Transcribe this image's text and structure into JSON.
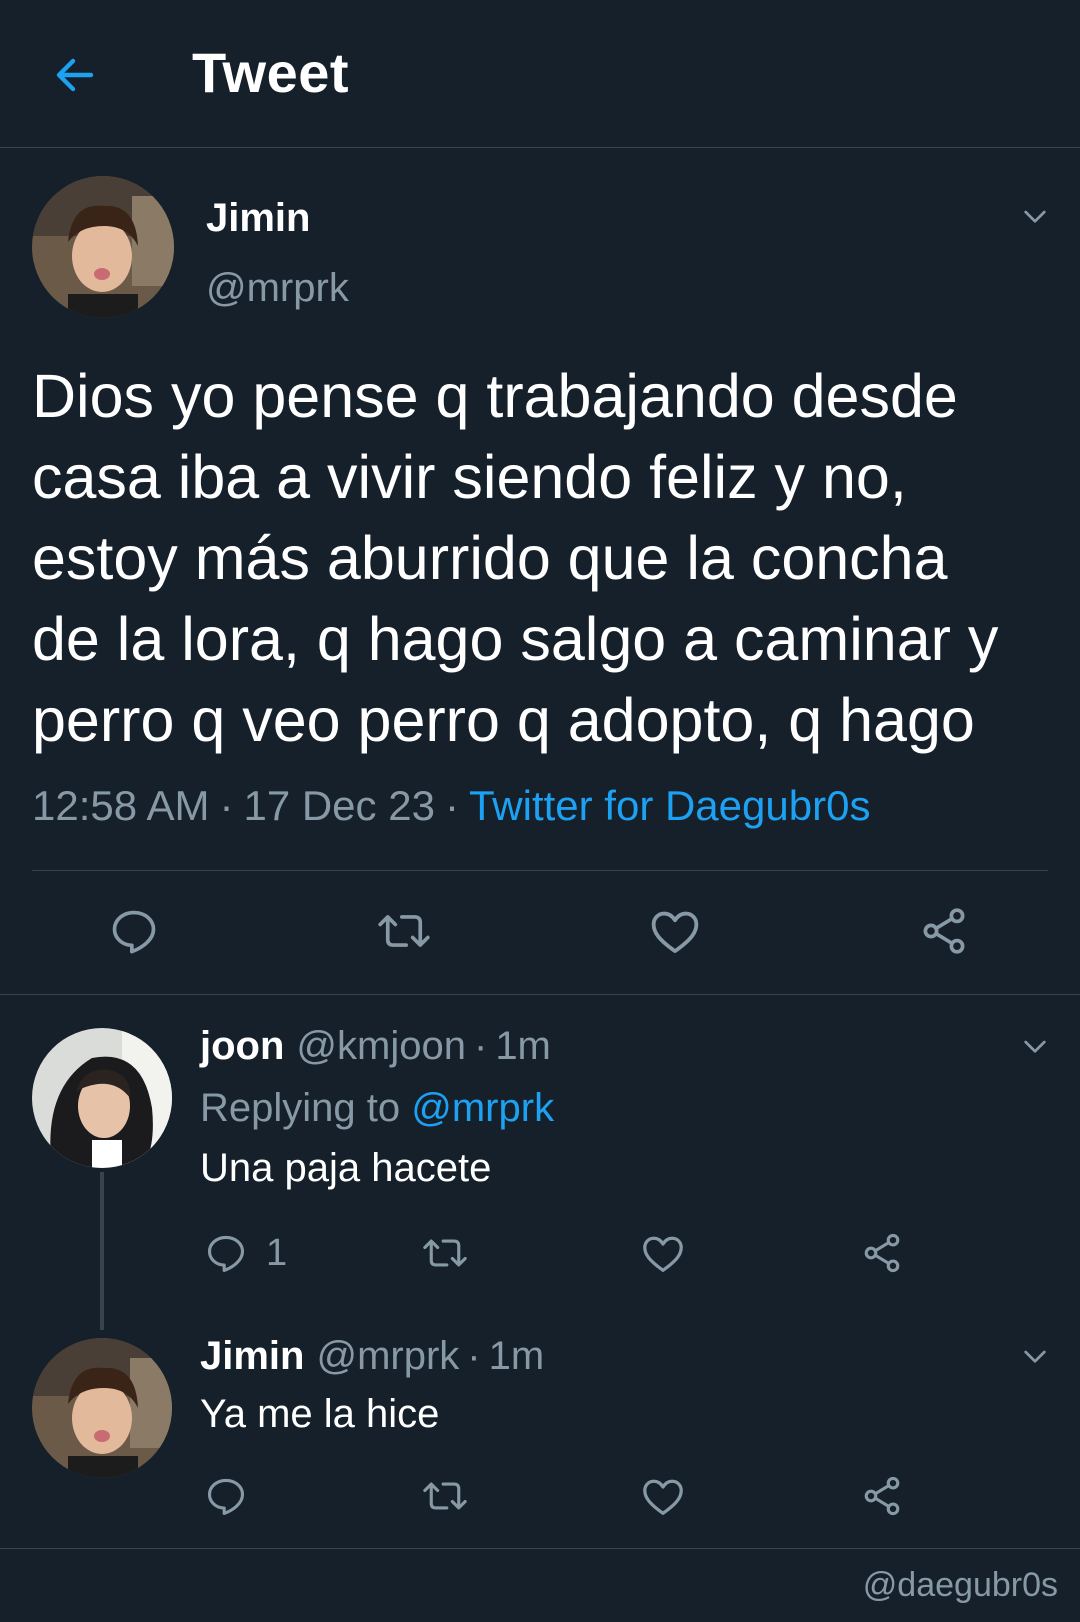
{
  "header": {
    "title": "Tweet",
    "back_icon": "arrow-left-icon",
    "accent_color": "#1da1f2"
  },
  "main_tweet": {
    "name": "Jimin",
    "handle": "@mrprk",
    "text": "Dios yo pense q trabajando desde\ncasa iba a vivir siendo feliz y no,\nestoy más aburrido que la concha\nde la lora, q hago salgo a caminar y\nperro q veo perro q adopto, q hago",
    "time": "12:58 AM",
    "separator": "·",
    "date": "17 Dec 23",
    "source": "Twitter for Daegubr0s",
    "actions": [
      "reply-icon",
      "retweet-icon",
      "like-icon",
      "share-icon"
    ]
  },
  "replies": [
    {
      "name": "joon",
      "handle": "@kmjoon",
      "separator": "·",
      "time": "1m",
      "replying_label": "Replying to",
      "replying_to": "@mrprk",
      "text": "Una paja hacete",
      "reply_count": "1"
    },
    {
      "name": "Jimin",
      "handle": "@mrprk",
      "separator": "·",
      "time": "1m",
      "text": "Ya me la hice"
    }
  ],
  "watermark": "@daegubr0s",
  "colors": {
    "background": "#15202b",
    "divider": "#38444d",
    "secondary_text": "#8899a6",
    "link": "#1da1f2"
  }
}
